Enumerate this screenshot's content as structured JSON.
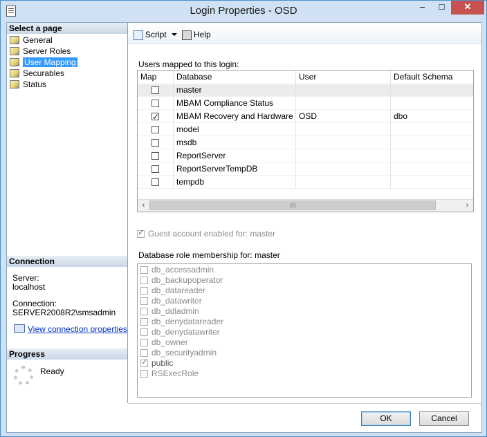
{
  "window": {
    "title": "Login Properties - OSD",
    "minimize": "–",
    "maximize": "□",
    "close": "✕"
  },
  "select_page": {
    "heading": "Select a page",
    "items": [
      {
        "label": "General",
        "icon": "page-icon"
      },
      {
        "label": "Server Roles",
        "icon": "page-icon"
      },
      {
        "label": "User Mapping",
        "icon": "page-icon",
        "selected": true
      },
      {
        "label": "Securables",
        "icon": "page-icon"
      },
      {
        "label": "Status",
        "icon": "page-icon"
      }
    ]
  },
  "connection": {
    "heading": "Connection",
    "server_label": "Server:",
    "server_value": "localhost",
    "connection_label": "Connection:",
    "connection_value": "SERVER2008R2\\smsadmin",
    "link": "View connection properties"
  },
  "progress": {
    "heading": "Progress",
    "status": "Ready"
  },
  "toolbar": {
    "script_label": "Script",
    "help_label": "Help"
  },
  "users_mapped": {
    "label": "Users mapped to this login:",
    "columns": [
      "Map",
      "Database",
      "User",
      "Default Schema"
    ],
    "rows": [
      {
        "map": false,
        "database": "master",
        "user": "",
        "schema": ""
      },
      {
        "map": false,
        "database": "MBAM Compliance Status",
        "user": "",
        "schema": ""
      },
      {
        "map": true,
        "database": "MBAM Recovery and Hardware",
        "user": "OSD",
        "schema": "dbo"
      },
      {
        "map": false,
        "database": "model",
        "user": "",
        "schema": ""
      },
      {
        "map": false,
        "database": "msdb",
        "user": "",
        "schema": ""
      },
      {
        "map": false,
        "database": "ReportServer",
        "user": "",
        "schema": ""
      },
      {
        "map": false,
        "database": "ReportServerTempDB",
        "user": "",
        "schema": ""
      },
      {
        "map": false,
        "database": "tempdb",
        "user": "",
        "schema": ""
      }
    ]
  },
  "guest": {
    "label": "Guest account enabled for: master",
    "checked": true
  },
  "role_membership": {
    "label": "Database role membership for: master",
    "roles": [
      {
        "name": "db_accessadmin",
        "checked": false
      },
      {
        "name": "db_backupoperator",
        "checked": false
      },
      {
        "name": "db_datareader",
        "checked": false
      },
      {
        "name": "db_datawriter",
        "checked": false
      },
      {
        "name": "db_ddladmin",
        "checked": false
      },
      {
        "name": "db_denydatareader",
        "checked": false
      },
      {
        "name": "db_denydatawriter",
        "checked": false
      },
      {
        "name": "db_owner",
        "checked": false
      },
      {
        "name": "db_securityadmin",
        "checked": false
      },
      {
        "name": "public",
        "checked": true
      },
      {
        "name": "RSExecRole",
        "checked": false
      }
    ]
  },
  "buttons": {
    "ok": "OK",
    "cancel": "Cancel"
  }
}
